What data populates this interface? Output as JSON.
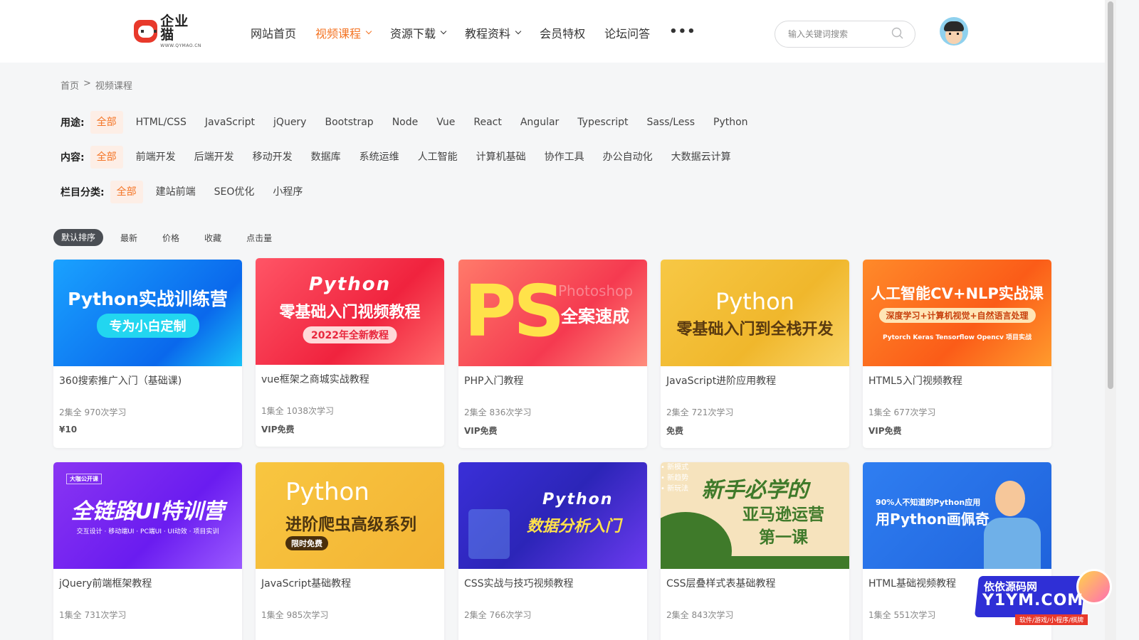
{
  "header": {
    "logo": {
      "name": "企业猫",
      "sub": "WWW.QYMAO.CN"
    },
    "nav": [
      {
        "label": "网站首页",
        "active": false,
        "dropdown": false
      },
      {
        "label": "视频课程",
        "active": true,
        "dropdown": true
      },
      {
        "label": "资源下载",
        "active": false,
        "dropdown": true
      },
      {
        "label": "教程资料",
        "active": false,
        "dropdown": true
      },
      {
        "label": "会员特权",
        "active": false,
        "dropdown": false
      },
      {
        "label": "论坛问答",
        "active": false,
        "dropdown": false
      }
    ],
    "more": "•••",
    "search_placeholder": "输入关键词搜索"
  },
  "breadcrumb": {
    "home": "首页",
    "sep": ">",
    "current": "视频课程"
  },
  "filters": {
    "usage": {
      "label": "用途:",
      "options": [
        "全部",
        "HTML/CSS",
        "JavaScript",
        "jQuery",
        "Bootstrap",
        "Node",
        "Vue",
        "React",
        "Angular",
        "Typescript",
        "Sass/Less",
        "Python"
      ]
    },
    "content": {
      "label": "内容:",
      "options": [
        "全部",
        "前端开发",
        "后端开发",
        "移动开发",
        "数据库",
        "系统运维",
        "人工智能",
        "计算机基础",
        "协作工具",
        "办公自动化",
        "大数据云计算"
      ]
    },
    "column": {
      "label": "栏目分类:",
      "options": [
        "全部",
        "建站前端",
        "SEO优化",
        "小程序"
      ]
    }
  },
  "sort": [
    "默认排序",
    "最新",
    "价格",
    "收藏",
    "点击量"
  ],
  "cards": [
    {
      "title": "360搜索推广入门（基础课)",
      "meta": "2集全 970次学习",
      "price": "¥10",
      "img": {
        "t1": "Python实战训练营",
        "t2": "专为小白定制"
      }
    },
    {
      "title": "vue框架之商城实战教程",
      "meta": "1集全 1038次学习",
      "price": "VIP免费",
      "img": {
        "t1": "Python",
        "t2": "零基础入门视频教程",
        "t3": "2022年全新教程"
      }
    },
    {
      "title": "PHP入门教程",
      "meta": "2集全 836次学习",
      "price": "VIP免费",
      "img": {
        "big": "PS",
        "t1": "Photoshop",
        "t2": "全案速成"
      }
    },
    {
      "title": "JavaScript进阶应用教程",
      "meta": "2集全 721次学习",
      "price": "免费",
      "img": {
        "t1": "Python",
        "t2": "零基础入门到全栈开发"
      }
    },
    {
      "title": "HTML5入门视频教程",
      "meta": "1集全 677次学习",
      "price": "VIP免费",
      "img": {
        "t1": "人工智能CV+NLP实战课",
        "t2": "深度学习+计算机视觉+自然语言处理",
        "t3": "Pytorch Keras Tensorflow Opencv 项目实战"
      }
    },
    {
      "title": "jQuery前端框架教程",
      "meta": "1集全 731次学习",
      "price": "",
      "img": {
        "t0": "大咖公开课",
        "t1": "全链路UI特训营",
        "t2": "交互设计 · 移动端UI · PC端UI · UI动效 · 项目实训"
      }
    },
    {
      "title": "JavaScript基础教程",
      "meta": "1集全 985次学习",
      "price": "",
      "img": {
        "t1": "Python",
        "t2": "进阶爬虫高级系列",
        "t3": "限时免费"
      }
    },
    {
      "title": "CSS实战与技巧视频教程",
      "meta": "2集全 766次学习",
      "price": "",
      "img": {
        "t1": "Python",
        "t2": "数据分析入门"
      }
    },
    {
      "title": "CSS层叠样式表基础教程",
      "meta": "2集全 843次学习",
      "price": "",
      "img": {
        "t1": "新手必学的",
        "t2": "亚马逊运营",
        "t3": "第一课",
        "t4": "• 新模式\n• 新趋势\n• 新玩法"
      }
    },
    {
      "title": "HTML基础视频教程",
      "meta": "1集全 551次学习",
      "price": "",
      "img": {
        "t1": "90%人不知道的Python应用",
        "t2": "用Python画佩奇"
      }
    }
  ],
  "watermark": {
    "t1": "依依源码网",
    "t2": "Y1YM.COM",
    "t3": "软件/游戏/小程序/棋牌"
  },
  "colors": {
    "accent": "#f47424",
    "active_bg": "#fdeee6",
    "sort_active": "#4a4e54"
  }
}
